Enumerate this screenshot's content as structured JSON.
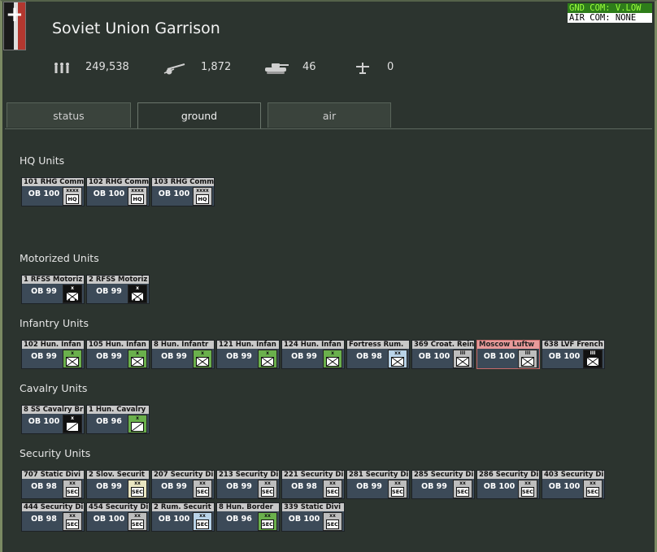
{
  "window": {
    "title": "Soviet Union Garrison"
  },
  "command": {
    "gnd": "GND COM: V.LOW",
    "air": "AIR COM: NONE"
  },
  "stats": [
    {
      "icon": "men-icon",
      "value": "249,538"
    },
    {
      "icon": "artillery-icon",
      "value": "1,872"
    },
    {
      "icon": "tank-icon",
      "value": "46"
    },
    {
      "icon": "aircraft-icon",
      "value": "0"
    }
  ],
  "tabs": [
    {
      "label": "status",
      "active": false
    },
    {
      "label": "ground",
      "active": true
    },
    {
      "label": "air",
      "active": false
    }
  ],
  "sections": [
    {
      "label": "HQ Units",
      "units": [
        {
          "name": "101 RHG Comm",
          "ob": "OB 100",
          "size": "xxxx",
          "type": "HQ",
          "color": "#c9c9c9"
        },
        {
          "name": "102 RHG Comm",
          "ob": "OB 100",
          "size": "xxxx",
          "type": "HQ",
          "color": "#c9c9c9"
        },
        {
          "name": "103 RHG Comm",
          "ob": "OB 100",
          "size": "xxxx",
          "type": "HQ",
          "color": "#c9c9c9"
        }
      ]
    },
    {
      "label": "Motorized Units",
      "units": [
        {
          "name": "1 RFSS Motoriz",
          "ob": "OB 99",
          "size": "x",
          "type": "motinf",
          "color": "#111111"
        },
        {
          "name": "2 RFSS Motoriz",
          "ob": "OB 99",
          "size": "x",
          "type": "motinf",
          "color": "#111111"
        }
      ]
    },
    {
      "label": "Infantry Units",
      "units": [
        {
          "name": "102 Hun. Infan",
          "ob": "OB 99",
          "size": "x",
          "type": "inf",
          "color": "#6ab04c"
        },
        {
          "name": "105 Hun. Infan",
          "ob": "OB 99",
          "size": "x",
          "type": "inf",
          "color": "#6ab04c"
        },
        {
          "name": "8 Hun. Infantr",
          "ob": "OB 99",
          "size": "x",
          "type": "inf",
          "color": "#6ab04c"
        },
        {
          "name": "121 Hun. Infan",
          "ob": "OB 99",
          "size": "x",
          "type": "inf",
          "color": "#6ab04c"
        },
        {
          "name": "124 Hun. Infan",
          "ob": "OB 99",
          "size": "x",
          "type": "inf",
          "color": "#6ab04c"
        },
        {
          "name": "Fortress Rum.",
          "ob": "OB 98",
          "size": "xx",
          "type": "inf",
          "color": "#b9d3e8"
        },
        {
          "name": "369 Croat. Rein",
          "ob": "OB 100",
          "size": "III",
          "type": "inf",
          "color": "#bdbdbd"
        },
        {
          "name": "Moscow Luftw",
          "ob": "OB 100",
          "size": "III",
          "type": "inf",
          "color": "#bdbdbd",
          "highlight": true
        },
        {
          "name": "638 LVF French",
          "ob": "OB 100",
          "size": "III",
          "type": "inf",
          "color": "#111111"
        }
      ]
    },
    {
      "label": "Cavalry Units",
      "units": [
        {
          "name": "8 SS Cavalry Br",
          "ob": "OB 100",
          "size": "x",
          "type": "cav",
          "color": "#111111"
        },
        {
          "name": "1 Hun. Cavalry",
          "ob": "OB 96",
          "size": "x",
          "type": "cav",
          "color": "#6ab04c"
        }
      ]
    },
    {
      "label": "Security Units",
      "units": [
        {
          "name": "707 Static Divi",
          "ob": "OB 98",
          "size": "xx",
          "type": "SEC",
          "color": "#bdbdbd"
        },
        {
          "name": "2 Slov. Securit",
          "ob": "OB 99",
          "size": "xx",
          "type": "SEC",
          "color": "#e8e4c0"
        },
        {
          "name": "207 Security Di",
          "ob": "OB 99",
          "size": "xx",
          "type": "SEC",
          "color": "#bdbdbd"
        },
        {
          "name": "213 Security Di",
          "ob": "OB 99",
          "size": "xx",
          "type": "SEC",
          "color": "#bdbdbd"
        },
        {
          "name": "221 Security Di",
          "ob": "OB 98",
          "size": "xx",
          "type": "SEC",
          "color": "#bdbdbd"
        },
        {
          "name": "281 Security Di",
          "ob": "OB 99",
          "size": "xx",
          "type": "SEC",
          "color": "#bdbdbd"
        },
        {
          "name": "285 Security Di",
          "ob": "OB 99",
          "size": "xx",
          "type": "SEC",
          "color": "#bdbdbd"
        },
        {
          "name": "286 Security Di",
          "ob": "OB 100",
          "size": "xx",
          "type": "SEC",
          "color": "#bdbdbd"
        },
        {
          "name": "403 Security Di",
          "ob": "OB 100",
          "size": "xx",
          "type": "SEC",
          "color": "#bdbdbd"
        },
        {
          "name": "444 Security Di",
          "ob": "OB 98",
          "size": "xx",
          "type": "SEC",
          "color": "#bdbdbd"
        },
        {
          "name": "454 Security Di",
          "ob": "OB 100",
          "size": "xx",
          "type": "SEC",
          "color": "#bdbdbd"
        },
        {
          "name": "2 Rum. Securit",
          "ob": "OB 100",
          "size": "xx",
          "type": "SEC",
          "color": "#b9d3e8"
        },
        {
          "name": "8 Hun. Border",
          "ob": "OB 96",
          "size": "xx",
          "type": "SEC",
          "color": "#6ab04c"
        },
        {
          "name": "339 Static Divi",
          "ob": "OB 100",
          "size": "xx",
          "type": "SEC",
          "color": "#bdbdbd"
        }
      ]
    }
  ]
}
